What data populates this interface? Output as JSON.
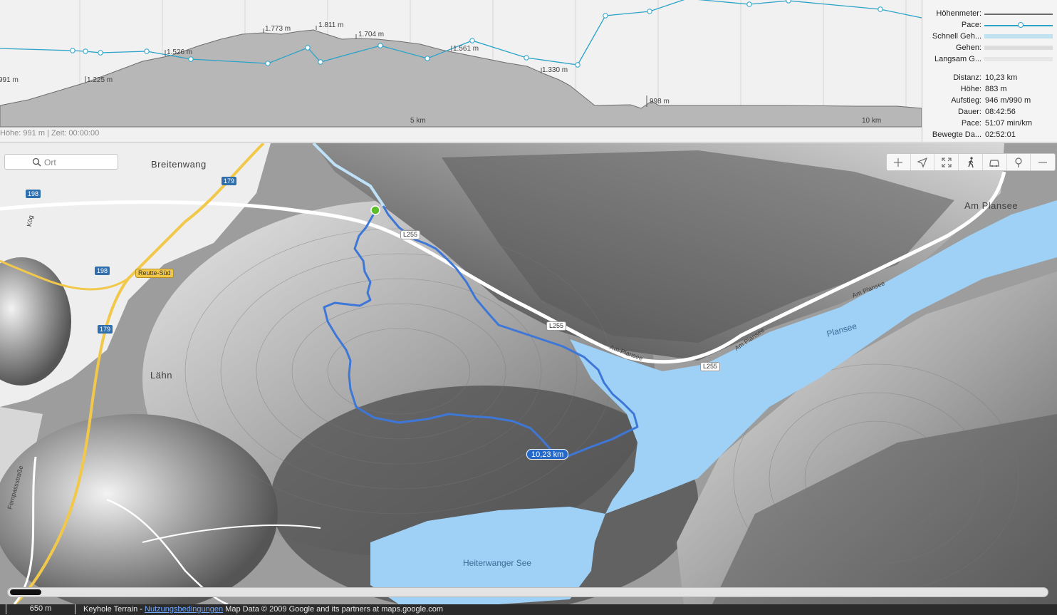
{
  "profile": {
    "status_text": "Höhe: 991 m | Zeit: 00:00:00",
    "elev_labels": [
      {
        "text": "991 m"
      },
      {
        "text": "1.225 m"
      },
      {
        "text": "1.526 m"
      },
      {
        "text": "1.773 m"
      },
      {
        "text": "1.811 m"
      },
      {
        "text": "1.704 m"
      },
      {
        "text": "1.561 m"
      },
      {
        "text": "1.330 m"
      },
      {
        "text": "998 m"
      }
    ],
    "km_labels": [
      "5 km",
      "10 km"
    ]
  },
  "legend": {
    "hoehenmeter": "Höhenmeter:",
    "pace": "Pace:",
    "schnell": "Schnell Geh...",
    "gehen": "Gehen:",
    "langsam": "Langsam G..."
  },
  "stats": [
    {
      "label": "Distanz:",
      "value": "10,23 km"
    },
    {
      "label": "Höhe:",
      "value": "883 m"
    },
    {
      "label": "Aufstieg:",
      "value": "946 m/990 m"
    },
    {
      "label": "Dauer:",
      "value": "08:42:56"
    },
    {
      "label": "Pace:",
      "value": "51:07 min/km"
    },
    {
      "label": "Bewegte Da...",
      "value": "02:52:01"
    }
  ],
  "search": {
    "placeholder": "Ort"
  },
  "map_toolbar": [
    "zoom-in",
    "locate",
    "fullscreen",
    "walk",
    "car",
    "map-pin",
    "zoom-out"
  ],
  "places": {
    "breitenwang": "Breitenwang",
    "laehn": "Lähn",
    "am_plansee": "Am Plansee",
    "plansee": "Plansee",
    "heiterwanger_see": "Heiterwanger See",
    "reutte_sued": "Reutte-Süd",
    "koeg": "Kög",
    "fernpassstrasse": "Fernpassstraße"
  },
  "roads": {
    "r198a": "198",
    "r198b": "198",
    "r179a": "179",
    "r179b": "179",
    "l255a": "L255",
    "l255b": "L255",
    "l255c": "L255",
    "am_plansee_road1": "Am Plansee",
    "am_plansee_road2": "Am Plansee",
    "am_plansee_road3": "Am Plansee"
  },
  "route": {
    "distance": "10,23 km"
  },
  "bottom": {
    "scale": "650 m",
    "attribution_prefix": "Keyhole Terrain - ",
    "terms_link": "Nutzungsbedingungen",
    "attribution_suffix": " Map Data © 2009 Google and its partners at maps.google.com"
  },
  "colors": {
    "route": "#3f77d6",
    "water": "#9fd1f7",
    "pace_line": "#2aa3c8",
    "elevation_fill": "#b5b5b5",
    "road_major": "#f2c84b"
  }
}
